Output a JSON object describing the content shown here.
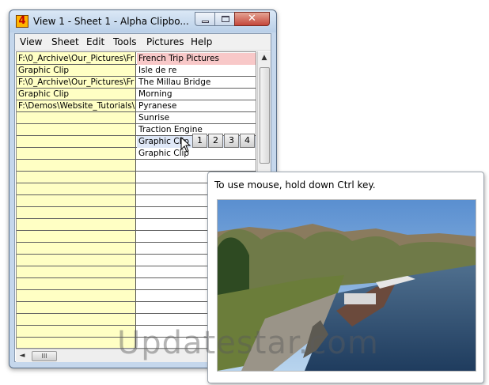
{
  "window": {
    "title": "View 1  -   Sheet 1   -   Alpha Clipbo...",
    "app_icon_glyph": "4",
    "close_glyph": "✕"
  },
  "menu": [
    "View",
    "Sheet",
    "Edit",
    "Tools",
    "Pictures",
    "Help"
  ],
  "grid": {
    "rows": [
      {
        "col1": "F:\\0_Archive\\Our_Pictures\\Fr",
        "col2": "French Trip Pictures"
      },
      {
        "col1": "Graphic Clip",
        "col2": "Isle de re"
      },
      {
        "col1": "F:\\0_Archive\\Our_Pictures\\Fr",
        "col2": "The Millau Bridge"
      },
      {
        "col1": "Graphic Clip",
        "col2": "Morning"
      },
      {
        "col1": "F:\\Demos\\Website_Tutorials\\",
        "col2": "Pyranese"
      },
      {
        "col1": "",
        "col2": "Sunrise"
      },
      {
        "col1": "",
        "col2": "Traction Engine"
      },
      {
        "col1": "",
        "col2": "Graphic Clip"
      },
      {
        "col1": "",
        "col2": "Graphic Clip"
      }
    ]
  },
  "pager": [
    "1",
    "2",
    "3",
    "4"
  ],
  "scrollbar": {
    "thumb_grip": "III",
    "left_arrow": "◄",
    "up_arrow": "▲"
  },
  "tooltip": {
    "text": "To use mouse, hold down Ctrl key."
  },
  "watermark": "Updatestar.com",
  "colors": {
    "column1_bg": "#ffffc4",
    "selected_row_bg": "#f8c8c8",
    "title_bar": "#c5d7ec",
    "close_button": "#c4463a"
  }
}
